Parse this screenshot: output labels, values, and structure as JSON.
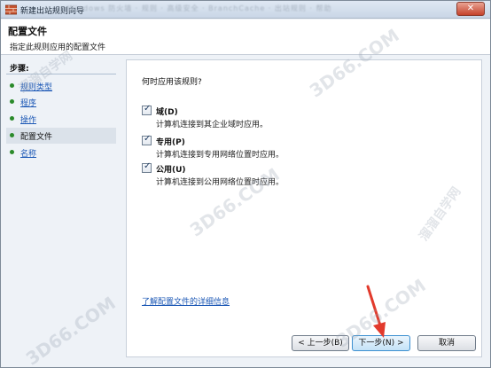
{
  "window": {
    "title": "新建出站规则向导",
    "close_label": "✕",
    "background_blur_text": "Windows 防火墙 · 规则 · 高级安全 · BranchCache · 出站规则 · 帮助"
  },
  "header": {
    "title": "配置文件",
    "subtitle": "指定此规则应用的配置文件"
  },
  "steps": {
    "title": "步骤:",
    "items": [
      {
        "label": "规则类型",
        "current": false
      },
      {
        "label": "程序",
        "current": false
      },
      {
        "label": "操作",
        "current": false
      },
      {
        "label": "配置文件",
        "current": true
      },
      {
        "label": "名称",
        "current": false
      }
    ]
  },
  "main": {
    "question": "何时应用该规则?",
    "options": [
      {
        "label": "域(D)",
        "desc": "计算机连接到其企业域时应用。",
        "checked": true
      },
      {
        "label": "专用(P)",
        "desc": "计算机连接到专用网络位置时应用。",
        "checked": true
      },
      {
        "label": "公用(U)",
        "desc": "计算机连接到公用网络位置时应用。",
        "checked": true
      }
    ],
    "learn_more": "了解配置文件的详细信息"
  },
  "buttons": {
    "back": "< 上一步(B)",
    "next": "下一步(N) >",
    "cancel": "取消"
  },
  "watermarks": [
    "3D66.COM",
    "3D66.COM",
    "3D66.COM",
    "3D66.COM",
    "溜溜自学网",
    "溜溜自学网"
  ],
  "colors": {
    "link": "#1b57b5",
    "step_dot": "#2a8a2a",
    "arrow": "#e23a2c",
    "close": "#c5422b"
  }
}
